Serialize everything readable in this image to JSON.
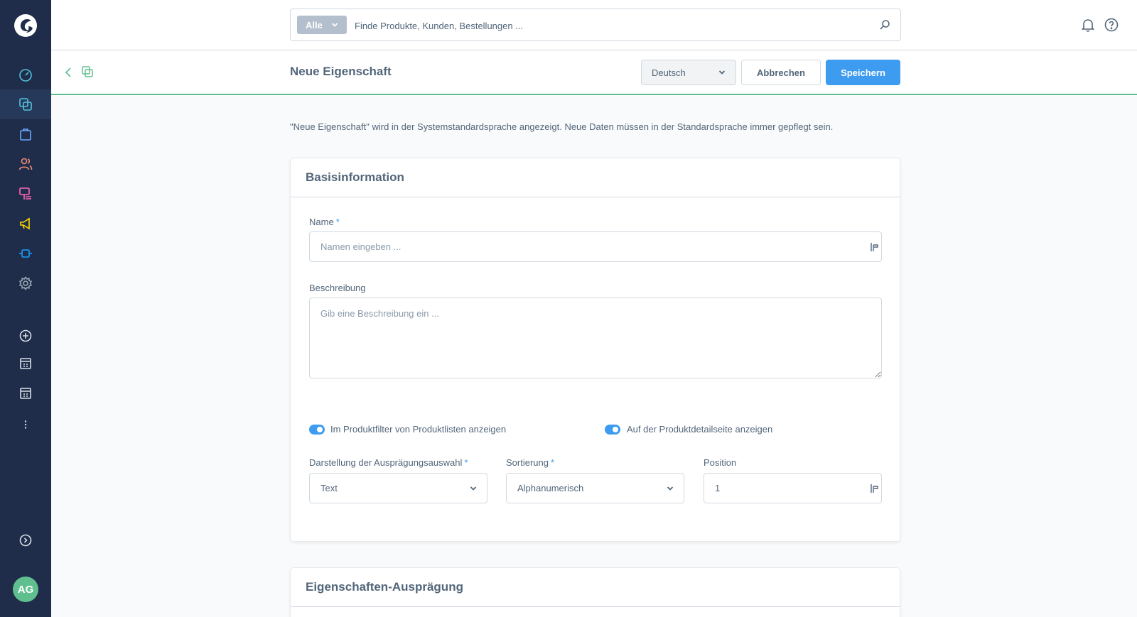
{
  "search": {
    "type_label": "Alle",
    "placeholder": "Finde Produkte, Kunden, Bestellungen ..."
  },
  "sidebar": {
    "items": [
      {
        "icon": "dashboard-icon",
        "color": "#52c4de"
      },
      {
        "icon": "catalog-icon",
        "color": "#52c4de"
      },
      {
        "icon": "orders-icon",
        "color": "#6ea8ff"
      },
      {
        "icon": "customers-icon",
        "color": "#f08a78"
      },
      {
        "icon": "content-icon",
        "color": "#ff68b4"
      },
      {
        "icon": "marketing-icon",
        "color": "#ffd700"
      },
      {
        "icon": "extensions-icon",
        "color": "#189eff"
      },
      {
        "icon": "settings-icon",
        "color": "#9aa8b5"
      },
      {
        "icon": "add-sales-channel-icon",
        "color": "#d8dde6"
      },
      {
        "icon": "storefront-icon",
        "color": "#d8dde6"
      },
      {
        "icon": "headless-icon",
        "color": "#d8dde6"
      },
      {
        "icon": "more-icon",
        "color": "#d8dde6"
      },
      {
        "icon": "collapse-icon",
        "color": "#d8dde6"
      }
    ],
    "avatar_initials": "AG"
  },
  "smartbar": {
    "title": "Neue Eigenschaft",
    "language": "Deutsch",
    "cancel_label": "Abbrechen",
    "save_label": "Speichern"
  },
  "notice": "\"Neue Eigenschaft\" wird in der Systemstandardsprache angezeigt. Neue Daten müssen in der Standardsprache immer gepflegt sein.",
  "basic_info": {
    "title": "Basisinformation",
    "name_label": "Name",
    "name_placeholder": "Namen eingeben ...",
    "description_label": "Beschreibung",
    "description_placeholder": "Gib eine Beschreibung ein ...",
    "filter_toggle_label": "Im Produktfilter von Produktlisten anzeigen",
    "detail_toggle_label": "Auf der Produktdetailseite anzeigen",
    "display_type_label": "Darstellung der Ausprägungsauswahl",
    "display_type_value": "Text",
    "sorting_label": "Sortierung",
    "sorting_value": "Alphanumerisch",
    "position_label": "Position",
    "position_value": "1",
    "required_marker": "*"
  },
  "options_card": {
    "title": "Eigenschaften-Ausprägung"
  },
  "colors": {
    "accent": "#3d9bf0",
    "sidebar": "#1f2d4a",
    "success": "#5fbf8f"
  }
}
